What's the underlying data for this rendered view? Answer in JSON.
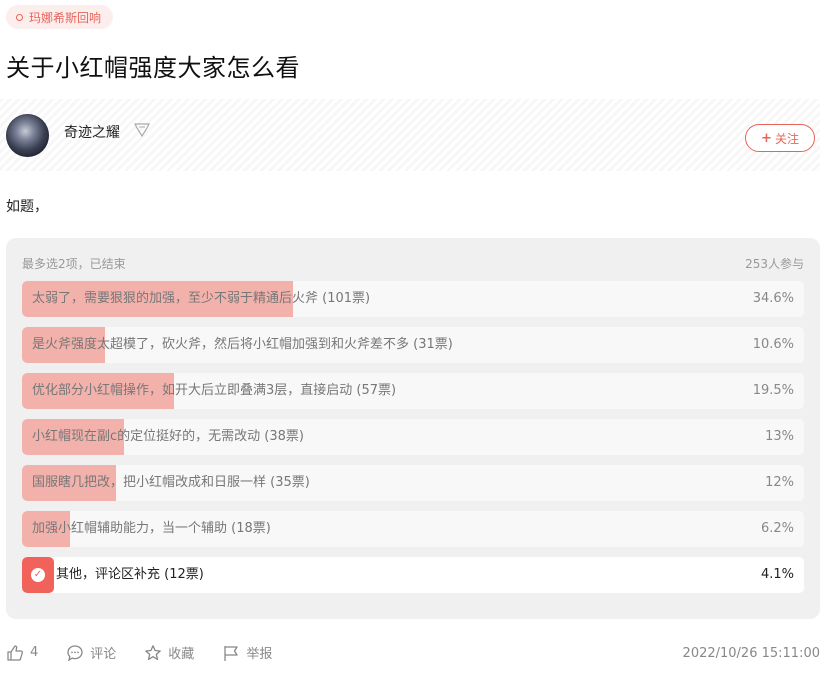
{
  "tag": {
    "label": "玛娜希斯回响"
  },
  "post": {
    "title": "关于小红帽强度大家怎么看",
    "body": "如题，"
  },
  "author": {
    "name": "奇迹之耀",
    "follow_label": "关注"
  },
  "poll": {
    "info": "最多选2项，已结束",
    "participants": "253人参与",
    "options": [
      {
        "label": "太弱了，需要狠狠的加强，至少不弱于精通后火斧 (101票)",
        "percent_text": "34.6%",
        "percent": 34.6,
        "selected": false
      },
      {
        "label": "是火斧强度太超模了，砍火斧，然后将小红帽加强到和火斧差不多 (31票)",
        "percent_text": "10.6%",
        "percent": 10.6,
        "selected": false
      },
      {
        "label": "优化部分小红帽操作，如开大后立即叠满3层，直接启动 (57票)",
        "percent_text": "19.5%",
        "percent": 19.5,
        "selected": false
      },
      {
        "label": "小红帽现在副c的定位挺好的，无需改动 (38票)",
        "percent_text": "13%",
        "percent": 13,
        "selected": false
      },
      {
        "label": "国服瞎几把改，把小红帽改成和日服一样 (35票)",
        "percent_text": "12%",
        "percent": 12,
        "selected": false
      },
      {
        "label": "加强小红帽辅助能力，当一个辅助 (18票)",
        "percent_text": "6.2%",
        "percent": 6.2,
        "selected": false
      },
      {
        "label": "其他，评论区补充 (12票)",
        "percent_text": "4.1%",
        "percent": 4.1,
        "selected": true
      }
    ]
  },
  "actions": {
    "like_count": "4",
    "comment_label": "评论",
    "favorite_label": "收藏",
    "report_label": "举报"
  },
  "date": "2022/10/26 15:11:00",
  "colors": {
    "accent": "#e8645a",
    "fill": "#f3b1ab",
    "selected_fill": "#f0625a"
  }
}
